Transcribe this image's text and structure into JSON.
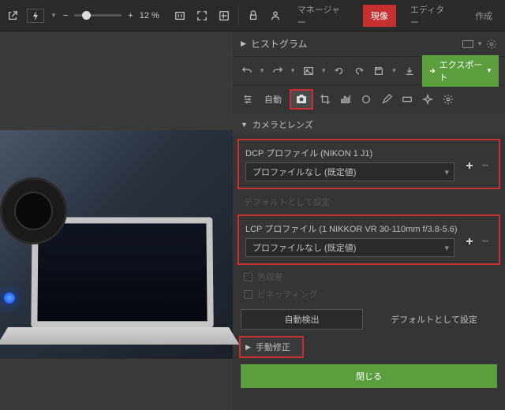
{
  "top": {
    "zoom": "12 %",
    "tabs": {
      "manager": "マネージャー",
      "develop": "現像",
      "editor": "エディター",
      "create": "作成"
    }
  },
  "panel": {
    "histogram": "ヒストグラム",
    "export": "エクスポート",
    "auto": "自動",
    "section": "カメラとレンズ",
    "dcp": {
      "label": "DCP プロファイル (NIKON 1 J1)",
      "value": "プロファイルなし (既定値)"
    },
    "default_set": "デフォルトとして設定",
    "lcp": {
      "label": "LCP プロファイル (1 NIKKOR VR 30-110mm f/3.8-5.6)",
      "value": "プロファイルなし (既定値)"
    },
    "ca": "色収差",
    "vig": "ビネッティング",
    "auto_detect": "自動検出",
    "default_btn": "デフォルトとして設定",
    "manual": "手動修正",
    "close": "閉じる"
  }
}
